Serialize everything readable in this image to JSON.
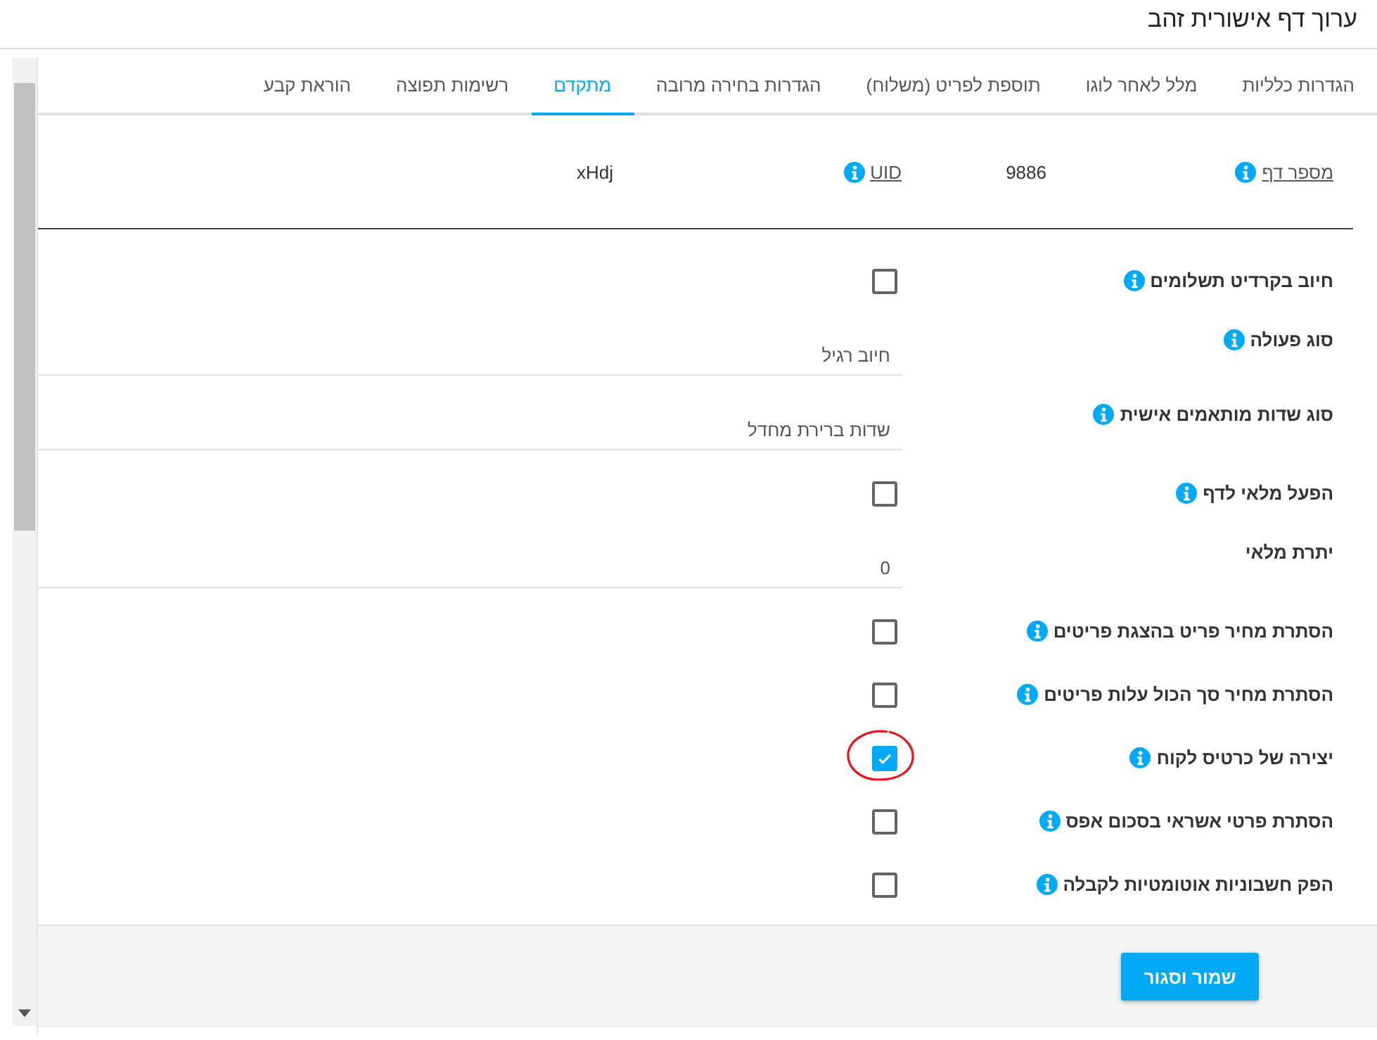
{
  "window": {
    "title": "ערוך דף אישורית זהב"
  },
  "tabs": [
    {
      "label": "הגדרות כלליות",
      "selected": false
    },
    {
      "label": "מלל לאחר לוגו",
      "selected": false
    },
    {
      "label": "תוספת לפריט (משלוח)",
      "selected": false
    },
    {
      "label": "הגדרות בחירה מרובה",
      "selected": false
    },
    {
      "label": "מתקדם",
      "selected": true
    },
    {
      "label": "רשימות תפוצה",
      "selected": false
    },
    {
      "label": "הוראת קבע",
      "selected": false
    }
  ],
  "info_row": [
    {
      "label": "מספר דף",
      "value": "9886",
      "info": true
    },
    {
      "label": "UID",
      "value": "xHdj",
      "info": true
    }
  ],
  "fields": [
    {
      "kind": "checkbox",
      "label": "חיוב בקרדיט תשלומים",
      "info": true,
      "checked": false
    },
    {
      "kind": "select",
      "label": "סוג פעולה",
      "info": true,
      "value": "חיוב רגיל"
    },
    {
      "kind": "select",
      "label": "סוג שדות מותאמים אישית",
      "info": true,
      "value": "שדות ברירת מחדל"
    },
    {
      "kind": "checkbox",
      "label": "הפעל מלאי לדף",
      "info": true,
      "checked": false
    },
    {
      "kind": "text",
      "label": "יתרת מלאי",
      "info": false,
      "value": "0"
    },
    {
      "kind": "checkbox",
      "label": "הסתרת מחיר פריט בהצגת פריטים",
      "info": true,
      "checked": false
    },
    {
      "kind": "checkbox",
      "label": "הסתרת מחיר סך הכול עלות פריטים",
      "info": true,
      "checked": false
    },
    {
      "kind": "checkbox",
      "label": "יצירה של כרטיס לקוח",
      "info": true,
      "checked": true,
      "circled": true
    },
    {
      "kind": "checkbox",
      "label": "הסתרת פרטי אשראי בסכום אפס",
      "info": true,
      "checked": false
    },
    {
      "kind": "checkbox",
      "label": "הפק חשבוניות אוטומטיות לקבלה",
      "info": true,
      "checked": false
    }
  ],
  "buttons": [
    "שמור וסגור"
  ]
}
